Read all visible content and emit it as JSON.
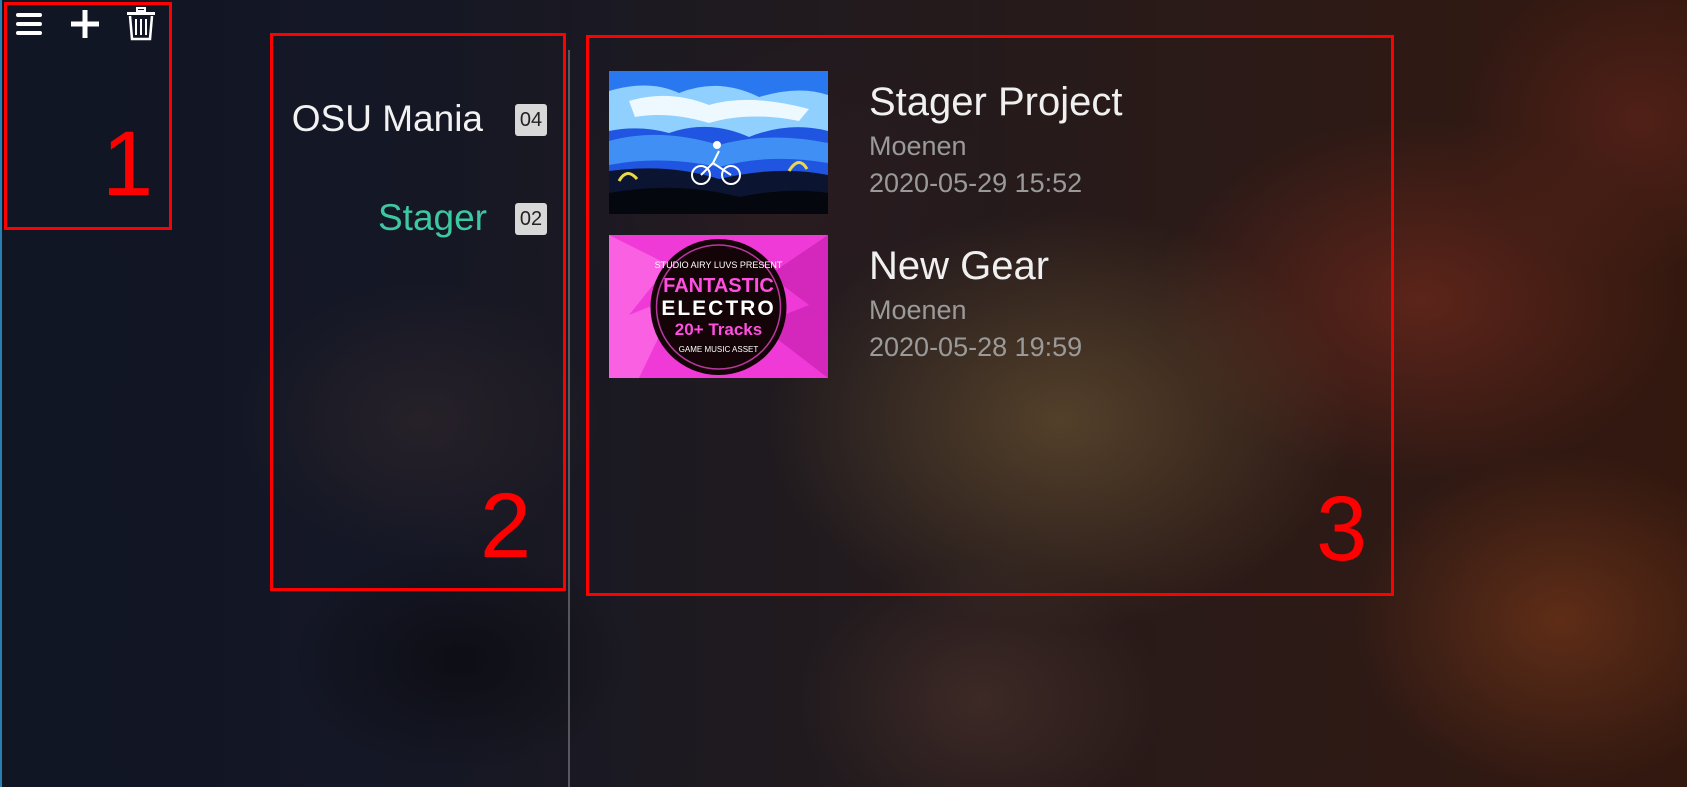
{
  "toolbar": {
    "icons": [
      "menu-icon",
      "plus-icon",
      "trash-icon"
    ]
  },
  "annotations": {
    "one": "1",
    "two": "2",
    "three": "3"
  },
  "categories": [
    {
      "label": "OSU Mania",
      "count": "04",
      "active": false
    },
    {
      "label": "Stager",
      "count": "02",
      "active": true
    }
  ],
  "songs": [
    {
      "title": "Stager Project",
      "artist": "Moenen",
      "date": "2020-05-29 15:52"
    },
    {
      "title": "New Gear",
      "artist": "Moenen",
      "date": "2020-05-28 19:59"
    }
  ],
  "cover2": {
    "line1": "STUDIO AIRY LUVS PRESENT",
    "line2": "FANTASTIC",
    "line3": "ELECTRO",
    "line4": "20+ Tracks",
    "line5": "GAME MUSIC ASSET"
  },
  "colors": {
    "accent": "#3cc8a0",
    "annotation": "#ff0000",
    "badge": "#d8d8d8"
  }
}
